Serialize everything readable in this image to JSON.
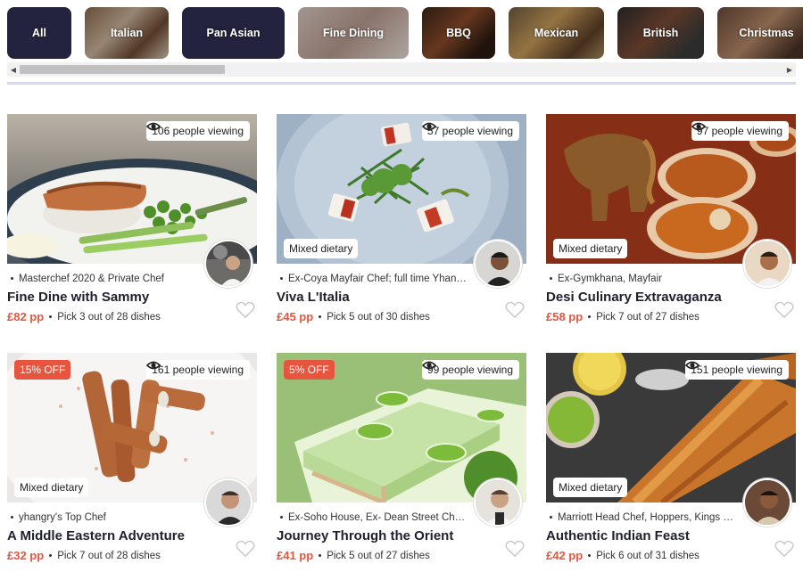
{
  "categories": [
    {
      "label": "All",
      "style": "dark"
    },
    {
      "label": "Italian",
      "style": "photo"
    },
    {
      "label": "Pan Asian",
      "style": "dark"
    },
    {
      "label": "Fine Dining",
      "style": "photo"
    },
    {
      "label": "BBQ",
      "style": "photo"
    },
    {
      "label": "Mexican",
      "style": "photo"
    },
    {
      "label": "British",
      "style": "photo"
    },
    {
      "label": "Christmas",
      "style": "photo"
    }
  ],
  "scrollbar": {
    "left_arrow": "◀",
    "right_arrow": "▶"
  },
  "colors": {
    "accent": "#e8553e",
    "category_dark": "#23233f",
    "divider": "#d8d9e6"
  },
  "menus": [
    {
      "viewing": "106 people viewing",
      "badge": "",
      "mixed": "",
      "chef": "Masterchef 2020 & Private Chef",
      "title": "Fine Dine with Sammy",
      "price": "£82 pp",
      "pick": "Pick 3 out of 28 dishes",
      "photo": "salmon-asparagus"
    },
    {
      "viewing": "57 people viewing",
      "badge": "",
      "mixed": "Mixed dietary",
      "chef": "Ex-Coya Mayfair Chef; full time Yhangry...",
      "title": "Viva L'Italia",
      "price": "£45 pp",
      "pick": "Pick 5 out of 30 dishes",
      "photo": "salad-plate"
    },
    {
      "viewing": "97 people viewing",
      "badge": "",
      "mixed": "Mixed dietary",
      "chef": "Ex-Gymkhana, Mayfair",
      "title": "Desi Culinary Extravaganza",
      "price": "£58 pp",
      "pick": "Pick 7 out of 27 dishes",
      "photo": "elephant-curry"
    },
    {
      "viewing": "161 people viewing",
      "badge": "15% OFF",
      "mixed": "Mixed dietary",
      "chef": "yhangry's Top Chef",
      "title": "A Middle Eastern Adventure",
      "price": "£32 pp",
      "pick": "Pick 7 out of 28 dishes",
      "photo": "rolls"
    },
    {
      "viewing": "99 people viewing",
      "badge": "5% OFF",
      "mixed": "",
      "chef": "Ex-Soho House, Ex- Dean Street Chef l...",
      "title": "Journey Through the Orient",
      "price": "£41 pp",
      "pick": "Pick 5 out of 27 dishes",
      "photo": "lime-cake"
    },
    {
      "viewing": "151 people viewing",
      "badge": "",
      "mixed": "Mixed dietary",
      "chef": "Marriott Head Chef, Hoppers, Kings Cro...",
      "title": "Authentic Indian Feast",
      "price": "£42 pp",
      "pick": "Pick 6 out of 31 dishes",
      "photo": "dosa"
    }
  ]
}
